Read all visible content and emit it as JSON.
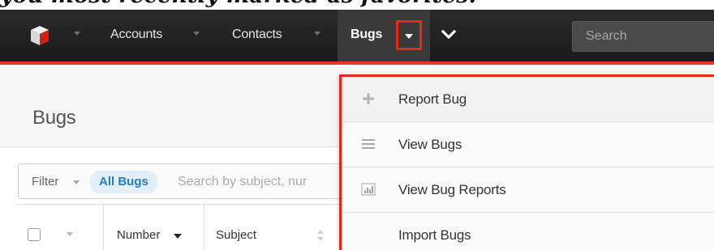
{
  "caption": {
    "text": "you most recently marked as favorites."
  },
  "navbar": {
    "items": [
      {
        "label": "Accounts"
      },
      {
        "label": "Contacts"
      },
      {
        "label": "Bugs"
      }
    ],
    "search": {
      "placeholder": "Search"
    },
    "active_tab": "Bugs",
    "accent_color": "#e8391f"
  },
  "page": {
    "title": "Bugs"
  },
  "filter": {
    "button_label": "Filter",
    "active_filter": "All Bugs",
    "search_placeholder": "Search by subject, nur"
  },
  "list": {
    "columns": [
      {
        "label": "Number"
      },
      {
        "label": "Subject"
      }
    ]
  },
  "dropdown": {
    "items": [
      {
        "label": "Report Bug",
        "icon": "plus-icon"
      },
      {
        "label": "View Bugs",
        "icon": "list-icon"
      },
      {
        "label": "View Bug Reports",
        "icon": "bar-chart-icon"
      },
      {
        "label": "Import Bugs",
        "icon": ""
      }
    ],
    "highlight_color": "#e8261a"
  }
}
